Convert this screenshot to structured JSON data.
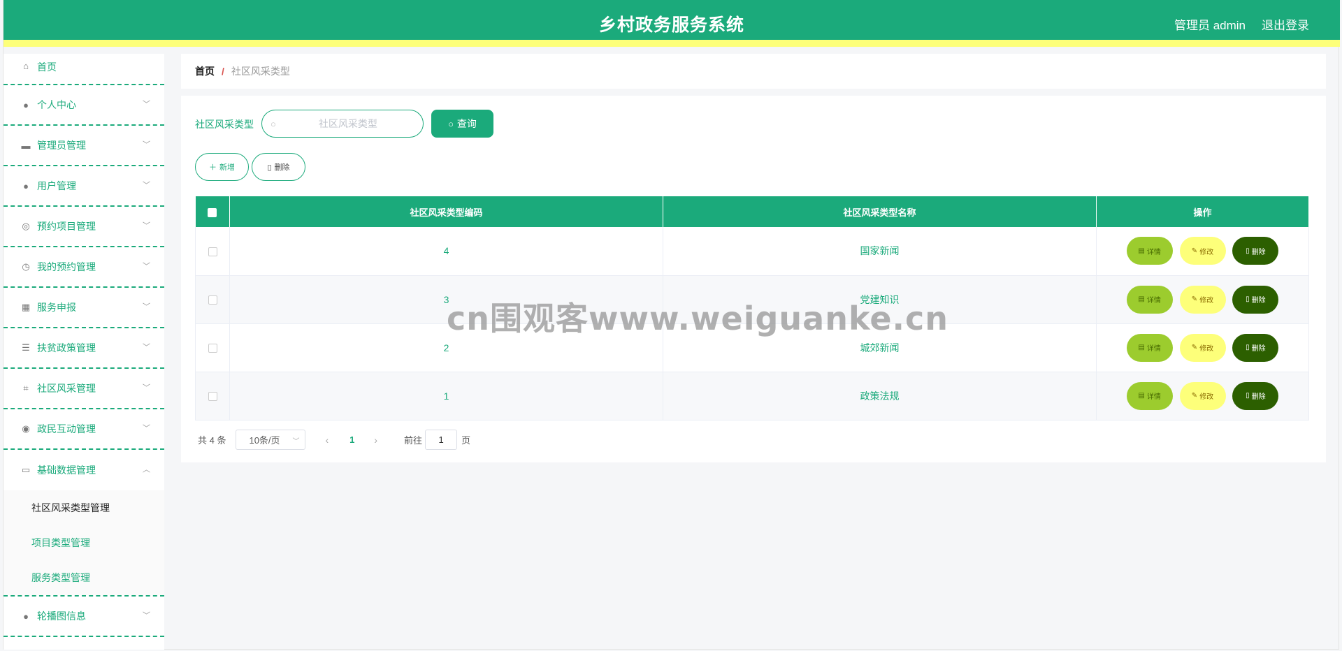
{
  "header": {
    "title": "乡村政务服务系统",
    "user": "管理员 admin",
    "logout": "退出登录"
  },
  "sidebar": {
    "items": [
      {
        "label": "首页",
        "icon": "home-icon",
        "glyph": "⌂"
      },
      {
        "label": "个人中心",
        "icon": "user-icon",
        "glyph": "●"
      },
      {
        "label": "管理员管理",
        "icon": "briefcase-icon",
        "glyph": "▬"
      },
      {
        "label": "用户管理",
        "icon": "user-icon",
        "glyph": "●"
      },
      {
        "label": "预约项目管理",
        "icon": "target-icon",
        "glyph": "◎"
      },
      {
        "label": "我的预约管理",
        "icon": "compass-icon",
        "glyph": "◷"
      },
      {
        "label": "服务申报",
        "icon": "grid-icon",
        "glyph": "▦"
      },
      {
        "label": "扶贫政策管理",
        "icon": "list-icon",
        "glyph": "☰"
      },
      {
        "label": "社区风采管理",
        "icon": "crop-icon",
        "glyph": "⌗"
      },
      {
        "label": "政民互动管理",
        "icon": "lifebuoy-icon",
        "glyph": "◉"
      },
      {
        "label": "基础数据管理",
        "icon": "id-card-icon",
        "glyph": "▭"
      },
      {
        "label": "轮播图信息",
        "icon": "balloon-icon",
        "glyph": "●"
      }
    ],
    "submenu": [
      {
        "label": "社区风采类型管理"
      },
      {
        "label": "项目类型管理"
      },
      {
        "label": "服务类型管理"
      }
    ]
  },
  "breadcrumb": {
    "home": "首页",
    "separator": "/",
    "current": "社区风采类型"
  },
  "search": {
    "label": "社区风采类型",
    "placeholder": "社区风采类型",
    "button": "查询"
  },
  "actions": {
    "add": "新增",
    "delete": "删除"
  },
  "table": {
    "columns": [
      "社区风采类型编码",
      "社区风采类型名称",
      "操作"
    ],
    "rows": [
      {
        "code": "4",
        "name": "国家新闻"
      },
      {
        "code": "3",
        "name": "党建知识"
      },
      {
        "code": "2",
        "name": "城郊新闻"
      },
      {
        "code": "1",
        "name": "政策法规"
      }
    ],
    "ops": {
      "detail": "详情",
      "edit": "修改",
      "delete": "删除"
    }
  },
  "pagination": {
    "total": "共 4 条",
    "page_size": "10条/页",
    "current_page": "1",
    "goto_prefix": "前往",
    "goto_value": "1",
    "goto_suffix": "页"
  },
  "watermark": "cn围观客www.weiguanke.cn",
  "colors": {
    "primary": "#1baa7b",
    "accent_yellow": "#fdff7a",
    "detail_green": "#9ccc2e",
    "delete_dark": "#2c5f00"
  }
}
